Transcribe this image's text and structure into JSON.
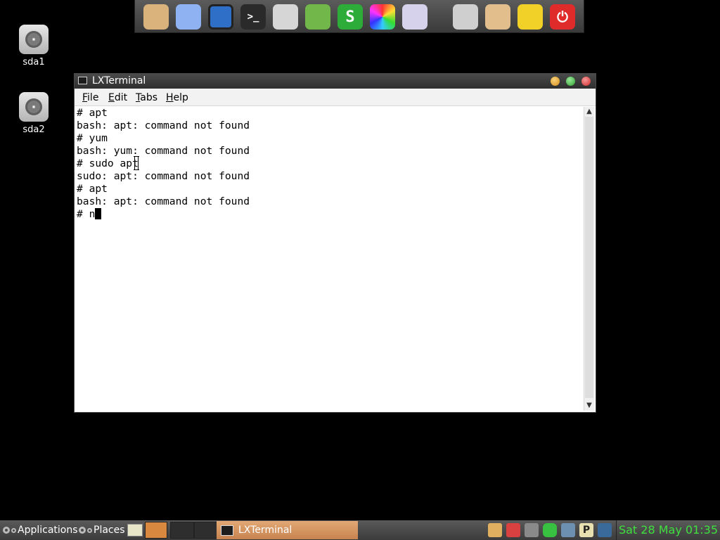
{
  "dock": {
    "icons": [
      {
        "name": "home-folder-icon",
        "color": "#d9b27c"
      },
      {
        "name": "cloud-icon",
        "color": "#8fb3f2"
      },
      {
        "name": "chat-icon",
        "color": "#2f6fc7"
      },
      {
        "name": "terminal-icon",
        "color": "#2a2a2a",
        "glyph": ">_"
      },
      {
        "name": "monitor-icon",
        "color": "#d6d6d6"
      },
      {
        "name": "document-writer-icon",
        "color": "#72b74a"
      },
      {
        "name": "spreadsheet-icon",
        "color": "#2eac3a",
        "glyph": "S"
      },
      {
        "name": "color-wheel-icon",
        "color": "#e04b8b"
      },
      {
        "name": "text-editor-icon",
        "color": "#d6d2ec"
      },
      {
        "name": "settings-sliders-icon",
        "color": "#cfcfcf"
      },
      {
        "name": "folder-icon",
        "color": "#e1be8c"
      },
      {
        "name": "signal-icon",
        "color": "#f1d127"
      },
      {
        "name": "power-icon",
        "color": "#e02b2b"
      }
    ]
  },
  "desktop": {
    "items": [
      {
        "label": "sda1"
      },
      {
        "label": "sda2"
      }
    ]
  },
  "window": {
    "title": "LXTerminal",
    "buttons": {
      "minimize_color": "#e0a02a",
      "maximize_color": "#3fb83f",
      "close_color": "#e03a3a"
    },
    "menu": [
      {
        "mnemonic": "F",
        "rest": "ile"
      },
      {
        "mnemonic": "E",
        "rest": "dit"
      },
      {
        "mnemonic": "T",
        "rest": "abs"
      },
      {
        "mnemonic": "H",
        "rest": "elp"
      }
    ],
    "terminal_lines": [
      "# apt",
      "bash: apt: command not found",
      "# yum",
      "bash: yum: command not found",
      "# sudo apt",
      "sudo: apt: command not found",
      "# apt",
      "bash: apt: command not found"
    ],
    "input_line": "# n"
  },
  "taskbar": {
    "applications_label": "Applications",
    "places_label": "Places",
    "task_title": "LXTerminal",
    "clock": "Sat 28 May 01:35",
    "tray_icons": [
      {
        "name": "user-icon",
        "color": "#e0b060"
      },
      {
        "name": "shield-icon",
        "color": "#d94040"
      },
      {
        "name": "volume-icon",
        "color": "#cccccc"
      },
      {
        "name": "battery-icon",
        "color": "#38c040"
      },
      {
        "name": "network-icon",
        "color": "#6d8fb0"
      },
      {
        "name": "clipboard-icon",
        "color": "#e8e0b0"
      },
      {
        "name": "cpu-graph-icon",
        "color": "#3a6a9a"
      }
    ]
  }
}
